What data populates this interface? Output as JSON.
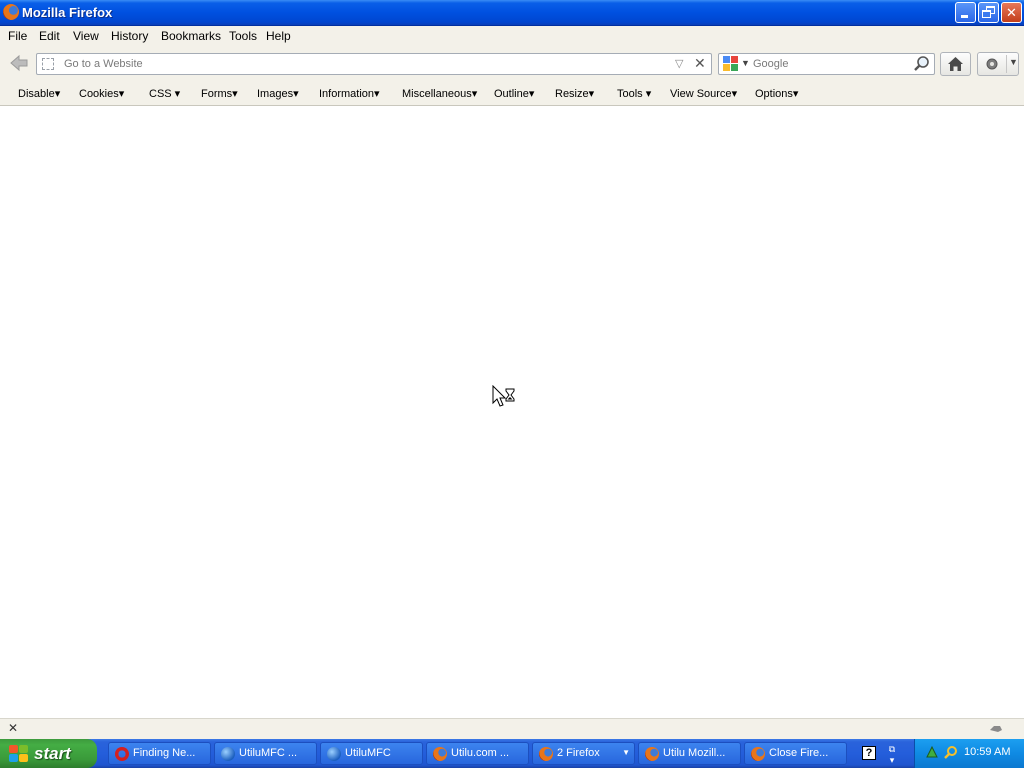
{
  "window": {
    "title": "Mozilla Firefox"
  },
  "menu": [
    "File",
    "Edit",
    "View",
    "History",
    "Bookmarks",
    "Tools",
    "Help"
  ],
  "navbar": {
    "url_placeholder": "Go to a Website",
    "search_placeholder": "Google"
  },
  "devtoolbar": [
    "Disable",
    "Cookies",
    "CSS",
    "Forms",
    "Images",
    "Information",
    "Miscellaneous",
    "Outline",
    "Resize",
    "Tools",
    "View Source",
    "Options"
  ],
  "taskbar": {
    "start_label": "start",
    "tasks": [
      {
        "label": "Finding Ne...",
        "icon": "opera-icon"
      },
      {
        "label": "UtiluMFC ...",
        "icon": "globe-icon"
      },
      {
        "label": "UtiluMFC",
        "icon": "globe-icon"
      },
      {
        "label": "Utilu.com ...",
        "icon": "firefox-icon"
      },
      {
        "label": "2 Firefox",
        "icon": "firefox-icon"
      },
      {
        "label": "Utilu Mozill...",
        "icon": "firefox-icon"
      },
      {
        "label": "Close Fire...",
        "icon": "firefox-icon"
      }
    ],
    "clock": "10:59 AM"
  },
  "colors": {
    "titlebar": "#0050e0",
    "taskbar": "#245edb",
    "start": "#3a9a3a",
    "chrome": "#f3f1e9"
  }
}
